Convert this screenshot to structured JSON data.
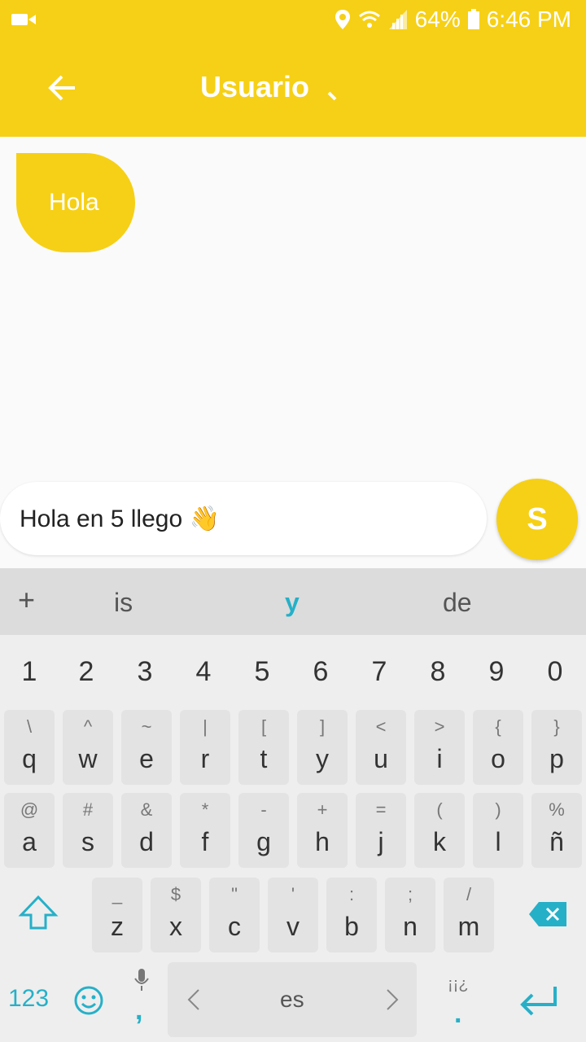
{
  "status": {
    "battery": "64%",
    "time": "6:46 PM"
  },
  "header": {
    "title": "Usuario"
  },
  "messages": [
    {
      "text": "Hola"
    }
  ],
  "composer": {
    "value": "Hola en 5 llego 👋",
    "send_label": "S"
  },
  "keyboard": {
    "suggestions": [
      "is",
      "y",
      "de"
    ],
    "numbers": [
      "1",
      "2",
      "3",
      "4",
      "5",
      "6",
      "7",
      "8",
      "9",
      "0"
    ],
    "row1": [
      [
        "\\",
        "q"
      ],
      [
        "^",
        "w"
      ],
      [
        "~",
        "e"
      ],
      [
        "|",
        "r"
      ],
      [
        "[",
        "t"
      ],
      [
        "]",
        "y"
      ],
      [
        "<",
        "u"
      ],
      [
        ">",
        "i"
      ],
      [
        "{",
        "o"
      ],
      [
        "}",
        "p"
      ]
    ],
    "row2": [
      [
        "@",
        "a"
      ],
      [
        "#",
        "s"
      ],
      [
        "&",
        "d"
      ],
      [
        "*",
        "f"
      ],
      [
        "-",
        "g"
      ],
      [
        "+",
        "h"
      ],
      [
        "=",
        "j"
      ],
      [
        "(",
        "k"
      ],
      [
        ")",
        "l"
      ],
      [
        "%",
        "ñ"
      ]
    ],
    "row3": [
      [
        "_",
        "z"
      ],
      [
        "$",
        "x"
      ],
      [
        "\"",
        "c"
      ],
      [
        "'",
        "v"
      ],
      [
        ":",
        "b"
      ],
      [
        ";",
        "n"
      ],
      [
        "/",
        "m"
      ]
    ],
    "bottom": {
      "numbers_label": "123",
      "comma": ",",
      "space_label": "es",
      "punct_label": "¡¡¿",
      "period": "."
    }
  }
}
